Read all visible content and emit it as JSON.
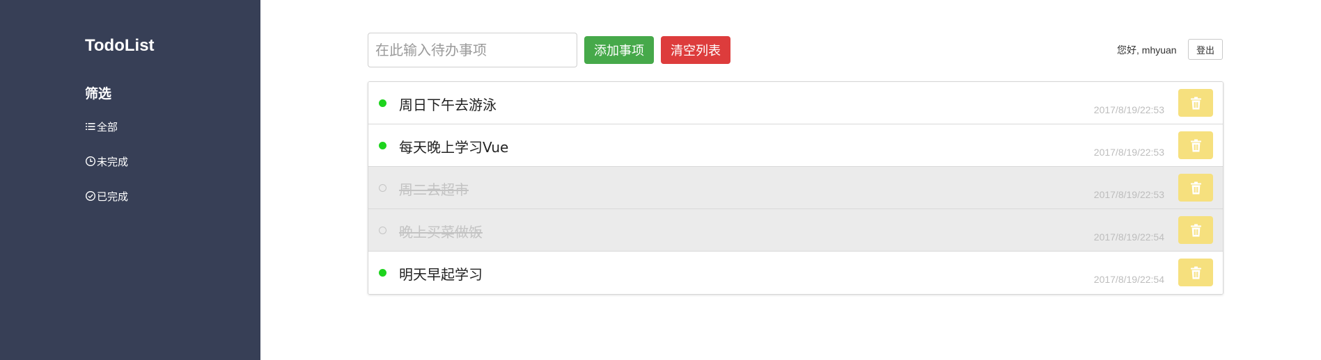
{
  "sidebar": {
    "brand": "TodoList",
    "filter_heading": "筛选",
    "filters": [
      {
        "label": "全部",
        "icon": "list-icon"
      },
      {
        "label": "未完成",
        "icon": "clock-icon"
      },
      {
        "label": "已完成",
        "icon": "check-circle-icon"
      }
    ]
  },
  "toolbar": {
    "input_placeholder": "在此输入待办事项",
    "input_value": "",
    "add_label": "添加事项",
    "clear_label": "清空列表"
  },
  "user": {
    "greeting": "您好, mhyuan",
    "logout_label": "登出"
  },
  "todos": [
    {
      "text": "周日下午去游泳",
      "time": "2017/8/19/22:53",
      "done": false
    },
    {
      "text": "每天晚上学习Vue",
      "time": "2017/8/19/22:53",
      "done": false
    },
    {
      "text": "周二去超市",
      "time": "2017/8/19/22:53",
      "done": true
    },
    {
      "text": "晚上买菜做饭",
      "time": "2017/8/19/22:54",
      "done": true
    },
    {
      "text": "明天早起学习",
      "time": "2017/8/19/22:54",
      "done": false
    }
  ],
  "colors": {
    "sidebar_bg": "#373f56",
    "add_button": "#46a94a",
    "clear_button": "#dd3c3c",
    "delete_button": "#f6e07e",
    "active_dot": "#1ed41e",
    "done_row_bg": "#ebebeb"
  },
  "icons": {
    "delete": "trash-icon"
  }
}
